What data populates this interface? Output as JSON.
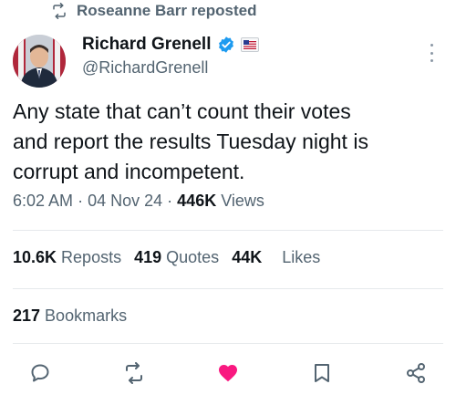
{
  "repost": {
    "text": "Roseanne Barr reposted"
  },
  "author": {
    "name": "Richard Grenell",
    "handle": "@RichardGrenell"
  },
  "tweet": {
    "lines": [
      "Any state that can’t count their votes",
      "and report the results Tuesday night is",
      "corrupt and incompetent."
    ]
  },
  "meta": {
    "time": "6:02 AM",
    "sep1": "·",
    "date": "04 Nov 24",
    "sep2": "·",
    "views_count": "446K",
    "views_label": "Views"
  },
  "stats": {
    "reposts_count": "10.6K",
    "reposts_label": "Reposts",
    "quotes_count": "419",
    "quotes_label": "Quotes",
    "likes_count": "44K",
    "likes_label": "Likes"
  },
  "bookmarks": {
    "count": "217",
    "label": "Bookmarks"
  },
  "colors": {
    "verified": "#1d9bf0",
    "like": "#f91880",
    "muted": "#536471",
    "text": "#0f1419"
  },
  "icons": [
    "repost-icon",
    "verified-badge-icon",
    "flag-badge-icon",
    "more-icon",
    "reply-icon",
    "retweet-icon",
    "heart-icon",
    "bookmark-icon",
    "share-icon"
  ]
}
